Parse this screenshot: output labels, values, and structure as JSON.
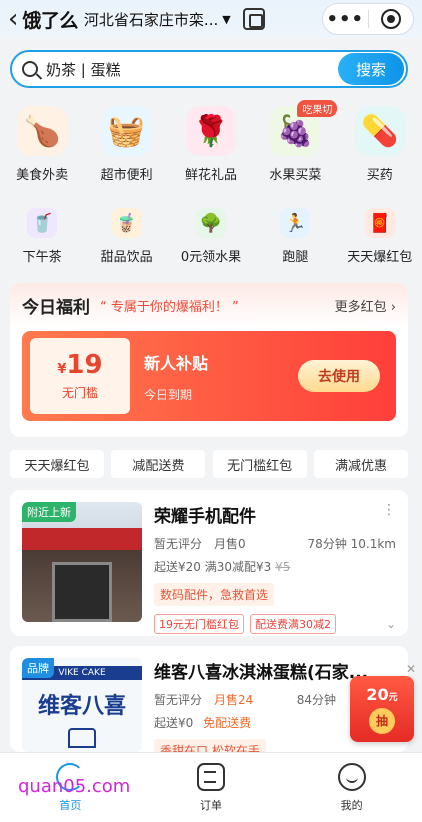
{
  "topbar": {
    "back_glyph": "‹",
    "brand": "饿了么",
    "address": "河北省石家庄市栾...",
    "more_glyph": "•••"
  },
  "search": {
    "value": "奶茶 | 蛋糕",
    "button": "搜索"
  },
  "categories_row1": [
    {
      "label": "美食外卖",
      "icon": "🍗",
      "bg": "#fff1e3"
    },
    {
      "label": "超市便利",
      "icon": "🧺",
      "bg": "#e8f6ff"
    },
    {
      "label": "鲜花礼品",
      "icon": "🌹",
      "bg": "#ffe8ef"
    },
    {
      "label": "水果买菜",
      "icon": "🍇",
      "bg": "#eef8e4",
      "badge": "吃果切"
    },
    {
      "label": "买药",
      "icon": "💊",
      "bg": "#e3f7f6"
    }
  ],
  "categories_row2": [
    {
      "label": "下午茶",
      "icon": "🥤",
      "bg": "#efe7fb"
    },
    {
      "label": "甜品饮品",
      "icon": "🧋",
      "bg": "#fff1da"
    },
    {
      "label": "0元领水果",
      "icon": "🌳",
      "bg": "#e6f6e8"
    },
    {
      "label": "跑腿",
      "icon": "🏃",
      "bg": "#e5f3fd"
    },
    {
      "label": "天天爆红包",
      "icon": "🧧",
      "bg": "#ffe9e0"
    }
  ],
  "welfare": {
    "title": "今日福利",
    "subtitle": "“ 专属于你的爆福利！ ”",
    "more": "更多红包 ›",
    "coupon": {
      "currency": "¥",
      "amount": "19",
      "condition": "无门槛",
      "name": "新人补贴",
      "expiry": "今日到期",
      "button": "去使用"
    }
  },
  "filters": [
    "天天爆红包",
    "减配送费",
    "无门槛红包",
    "满减优惠"
  ],
  "shops": [
    {
      "tag": "附近上新",
      "name": "荣耀手机配件",
      "rating": "暂无评分",
      "sales": "月售0",
      "time": "78分钟 10.1km",
      "min_order": "起送¥20",
      "delivery": "满30减配¥3",
      "orig_fee": "¥5",
      "recommend": "数码配件，急救首选",
      "promos": [
        "19元无门槛红包",
        "配送费满30减2"
      ]
    },
    {
      "tag": "品牌",
      "name": "维客八喜冰淇淋蛋糕(石家...",
      "rating": "暂无评分",
      "sales": "月售24",
      "time": "84分钟",
      "min_order": "起送¥0",
      "delivery": "免配送费",
      "recommend": "香甜在口,松软在手"
    }
  ],
  "float_packet": {
    "amount": "20",
    "unit": "元",
    "button": "抽"
  },
  "nav": [
    {
      "label": "首页",
      "active": true
    },
    {
      "label": "订单",
      "active": false
    },
    {
      "label": "我的",
      "active": false
    }
  ],
  "watermark": "quan05.com"
}
